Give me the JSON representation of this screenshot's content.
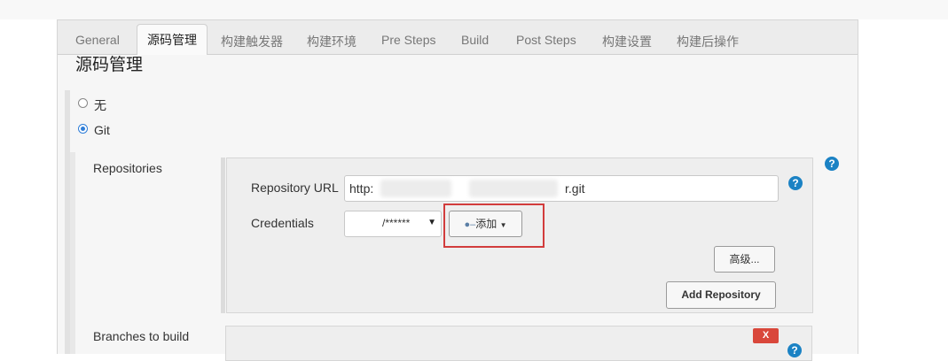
{
  "tabs": [
    {
      "label": "General",
      "active": false
    },
    {
      "label": "源码管理",
      "active": true
    },
    {
      "label": "构建触发器",
      "active": false
    },
    {
      "label": "构建环境",
      "active": false
    },
    {
      "label": "Pre Steps",
      "active": false
    },
    {
      "label": "Build",
      "active": false
    },
    {
      "label": "Post Steps",
      "active": false
    },
    {
      "label": "构建设置",
      "active": false
    },
    {
      "label": "构建后操作",
      "active": false
    }
  ],
  "scm": {
    "section_title": "源码管理",
    "option_none": "无",
    "option_git": "Git",
    "selected": "Git"
  },
  "repositories": {
    "label": "Repositories",
    "url_label": "Repository URL",
    "url_prefix": "http:",
    "url_suffix": "r.git",
    "credentials_label": "Credentials",
    "credentials_value": "/******",
    "add_label": "添加",
    "advanced_label": "高级...",
    "add_repository_label": "Add Repository"
  },
  "branches": {
    "label": "Branches to build",
    "delete_label": "X"
  },
  "help_glyph": "?",
  "icons": [
    "key-icon",
    "caret-down-icon",
    "help-icon"
  ],
  "colors": {
    "help": "#1b82c4",
    "highlight": "#d23c3c",
    "delete": "#d9473b",
    "radio": "#2f7ed8"
  }
}
